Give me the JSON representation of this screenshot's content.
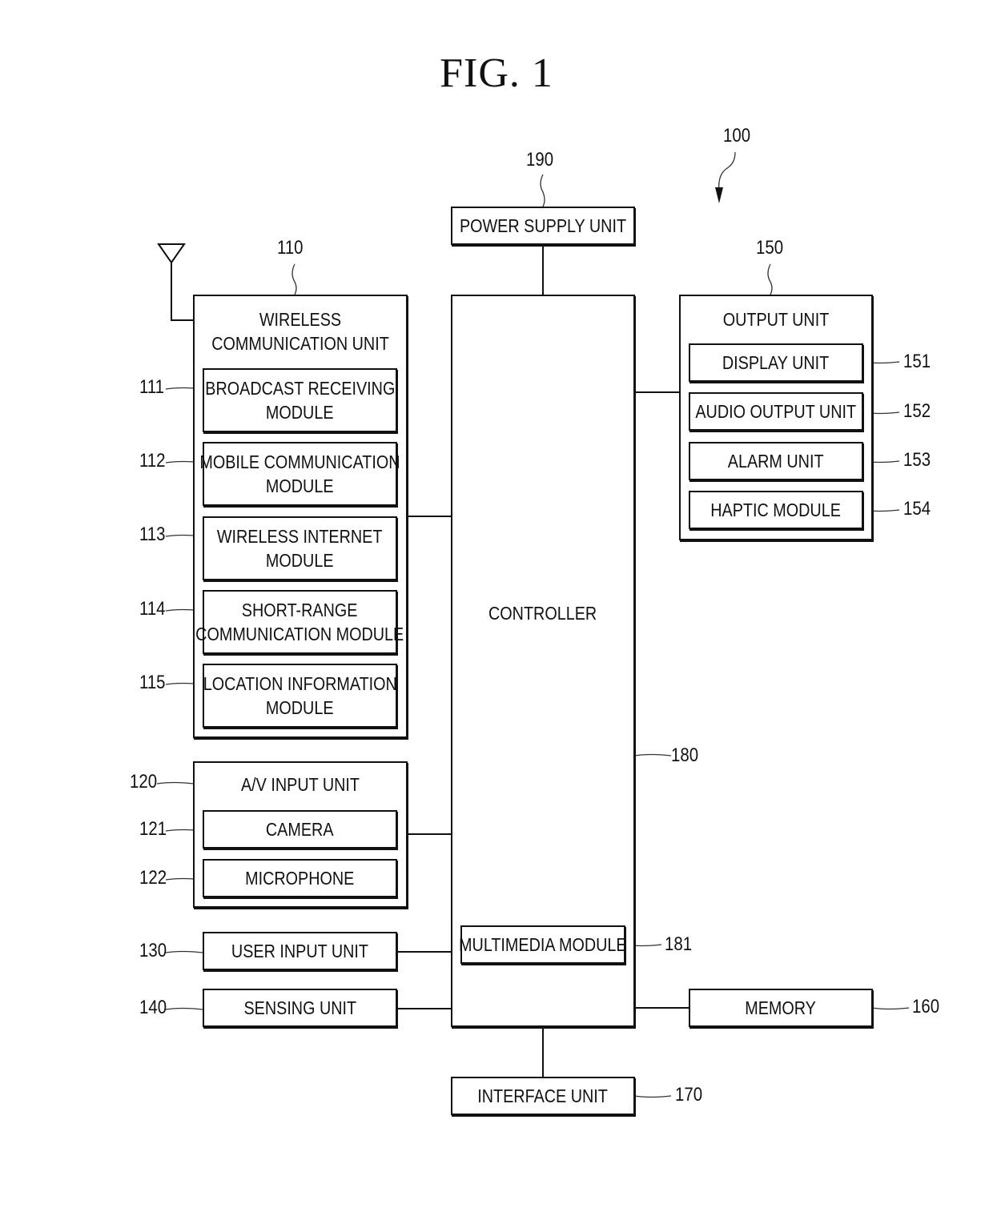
{
  "figure_title": "FIG. 1",
  "device_ref": "100",
  "power_supply": {
    "ref": "190",
    "label": "POWER SUPPLY UNIT"
  },
  "wireless_unit": {
    "ref": "110",
    "label_line1": "WIRELESS",
    "label_line2": "COMMUNICATION UNIT",
    "modules": [
      {
        "ref": "111",
        "line1": "BROADCAST RECEIVING",
        "line2": "MODULE"
      },
      {
        "ref": "112",
        "line1": "MOBILE COMMUNICATION",
        "line2": "MODULE"
      },
      {
        "ref": "113",
        "line1": "WIRELESS INTERNET",
        "line2": "MODULE"
      },
      {
        "ref": "114",
        "line1": "SHORT-RANGE",
        "line2": "COMMUNICATION MODULE"
      },
      {
        "ref": "115",
        "line1": "LOCATION INFORMATION",
        "line2": "MODULE"
      }
    ]
  },
  "av_input": {
    "ref": "120",
    "label": "A/V INPUT UNIT",
    "items": [
      {
        "ref": "121",
        "label": "CAMERA"
      },
      {
        "ref": "122",
        "label": "MICROPHONE"
      }
    ]
  },
  "user_input": {
    "ref": "130",
    "label": "USER INPUT UNIT"
  },
  "sensing": {
    "ref": "140",
    "label": "SENSING UNIT"
  },
  "output_unit": {
    "ref": "150",
    "label": "OUTPUT UNIT",
    "items": [
      {
        "ref": "151",
        "label": "DISPLAY UNIT"
      },
      {
        "ref": "152",
        "label": "AUDIO OUTPUT UNIT"
      },
      {
        "ref": "153",
        "label": "ALARM UNIT"
      },
      {
        "ref": "154",
        "label": "HAPTIC MODULE"
      }
    ]
  },
  "memory": {
    "ref": "160",
    "label": "MEMORY"
  },
  "interface": {
    "ref": "170",
    "label": "INTERFACE UNIT"
  },
  "controller": {
    "ref": "180",
    "label": "CONTROLLER"
  },
  "multimedia": {
    "ref": "181",
    "label": "MULTIMEDIA MODULE"
  }
}
